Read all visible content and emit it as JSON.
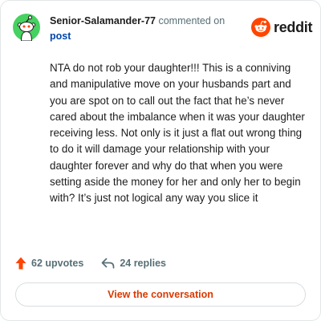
{
  "header": {
    "username": "Senior-Salamander-77",
    "action_text": "commented on",
    "post_link": "post"
  },
  "brand": {
    "wordmark": "reddit",
    "icon": "reddit-logo-icon",
    "color": "#ff4500"
  },
  "avatar": {
    "icon": "snoo-avatar-icon",
    "background": "#46d160"
  },
  "comment": {
    "body": "NTA do not rob your daughter!!! This is a conniving and manipulative move on your husbands part and you are spot on to call out the fact that he’s never cared about the imbalance when it was your daughter receiving less. Not only is it just a flat out wrong thing to do it will damage your relationship with your daughter forever and why do that when you were setting aside the money for her and only her to begin with? It’s just not logical any way you slice it"
  },
  "stats": {
    "upvotes": "62 upvotes",
    "upvote_icon": "upvote-arrow-icon",
    "replies": "24 replies",
    "reply_icon": "reply-arrow-icon"
  },
  "cta": {
    "label": "View the conversation",
    "color": "#d93a00"
  }
}
